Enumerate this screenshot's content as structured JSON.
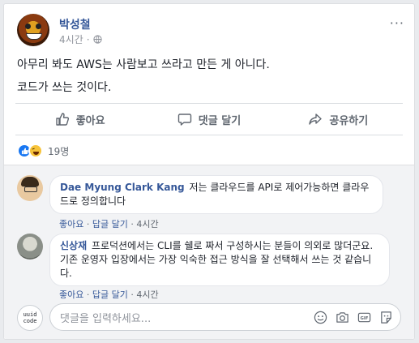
{
  "post": {
    "author": "박성철",
    "time": "4시간",
    "more": "···",
    "lines": [
      "아무리 봐도 AWS는 사람보고 쓰라고 만든 게 아니다.",
      "코드가 쓰는 것이다."
    ]
  },
  "actions": {
    "like": "좋아요",
    "comment": "댓글 달기",
    "share": "공유하기"
  },
  "reactions": {
    "count": "19명"
  },
  "comments": [
    {
      "name": "Dae Myung Clark Kang",
      "text": " 저는 클라우드를 API로 제어가능하면 클라우드로 정의합니다",
      "like": "좋아요",
      "sep1": " · ",
      "reply": "답글 달기",
      "sep2": " · ",
      "time": "4시간"
    },
    {
      "name": "신상재",
      "text": " 프로덕션에서는 CLI를 쉘로 짜서 구성하시는 분들이 의외로 많더군요. 기존 운영자 입장에서는 가장 익숙한 접근 방식을 잘 선택해서 쓰는 것 같습니다.",
      "like": "좋아요",
      "sep1": " · ",
      "reply": "답글 달기",
      "sep2": " · ",
      "time": "4시간"
    }
  ],
  "composer": {
    "avatar_line1": "uuid",
    "avatar_line2": "code",
    "placeholder": "댓글을 입력하세요...",
    "icons": [
      "emoji-icon",
      "camera-icon",
      "gif-icon",
      "sticker-icon"
    ],
    "gif_label": "GIF"
  },
  "colors": {
    "link": "#365899",
    "like_blue": "#1877f2",
    "haha_yellow": "#f7c33a"
  }
}
